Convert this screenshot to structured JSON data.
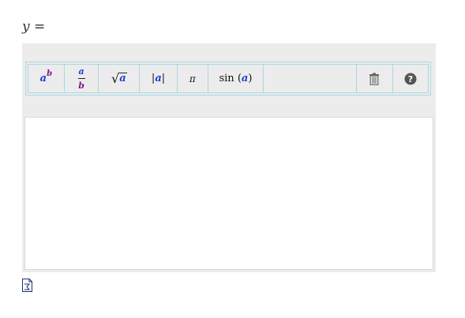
{
  "prompt": {
    "label": "y ="
  },
  "toolbar": {
    "buttons": [
      {
        "name": "power-button",
        "icon": "power-template-icon",
        "base": "a",
        "exponent": "b"
      },
      {
        "name": "fraction-button",
        "icon": "fraction-template-icon",
        "numerator": "a",
        "denominator": "b"
      },
      {
        "name": "sqrt-button",
        "icon": "square-root-icon",
        "radicand": "a"
      },
      {
        "name": "abs-button",
        "icon": "absolute-value-icon",
        "left": "|",
        "var": "a",
        "right": "|"
      },
      {
        "name": "pi-button",
        "icon": "pi-icon",
        "symbol": "π"
      },
      {
        "name": "sin-button",
        "icon": "sine-function-icon",
        "fn": "sin",
        "open": "(",
        "var": "a",
        "close": ")"
      },
      {
        "name": "clear-button",
        "icon": "trash-icon"
      },
      {
        "name": "help-button",
        "icon": "question-circle-icon",
        "glyph": "?"
      }
    ]
  },
  "answer": {
    "value": ""
  },
  "colors": {
    "panel_bg": "#ececec",
    "toolbar_border": "#a9d8e0",
    "var_a": "#1a3ed6",
    "var_b": "#7a1a8a",
    "icon_gray": "#555555"
  },
  "footer": {
    "icon": "document-formula-icon"
  }
}
